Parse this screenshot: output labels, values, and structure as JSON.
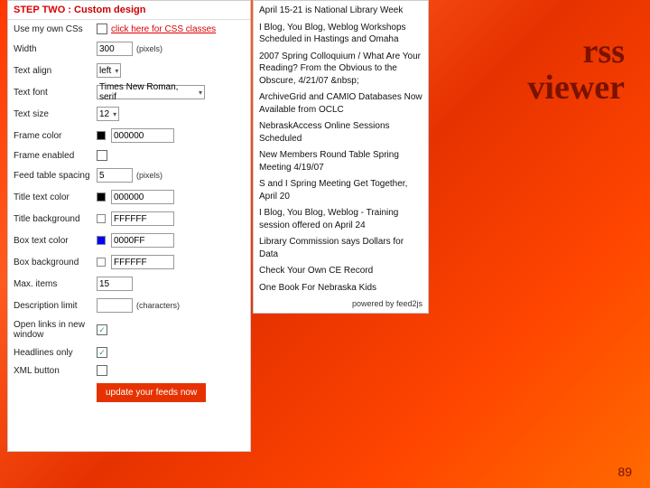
{
  "header": {
    "step": "STEP TWO :",
    "label": "Custom design"
  },
  "css_row": {
    "label": "Use my own CSs",
    "link": "click here for CSS classes"
  },
  "width_row": {
    "label": "Width",
    "value": "300",
    "suffix": "(pixels)"
  },
  "textalign_row": {
    "label": "Text align",
    "value": "left"
  },
  "textfont_row": {
    "label": "Text font",
    "value": "Times New Roman, serif"
  },
  "textsize_row": {
    "label": "Text size",
    "value": "12"
  },
  "framecolor_row": {
    "label": "Frame color",
    "value": "000000",
    "swatch": "#000000"
  },
  "frameenabled_row": {
    "label": "Frame enabled"
  },
  "feedspacing_row": {
    "label": "Feed table spacing",
    "value": "5",
    "suffix": "(pixels)"
  },
  "titletext_row": {
    "label": "Title text color",
    "value": "000000",
    "swatch": "#000000"
  },
  "titlebg_row": {
    "label": "Title background",
    "value": "FFFFFF",
    "swatch": "#ffffff"
  },
  "boxtext_row": {
    "label": "Box text color",
    "value": "0000FF",
    "swatch": "#0000ff"
  },
  "boxbg_row": {
    "label": "Box background",
    "value": "FFFFFF",
    "swatch": "#ffffff"
  },
  "maxitems_row": {
    "label": "Max. items",
    "value": "15"
  },
  "desclimit_row": {
    "label": "Description limit",
    "value": "",
    "suffix": "(characters)"
  },
  "openlinks_row": {
    "label": "Open links in new window",
    "checked": "✓"
  },
  "headlines_row": {
    "label": "Headlines only",
    "checked": "✓"
  },
  "xmlbutton_row": {
    "label": "XML button"
  },
  "update_btn": "update your feeds now",
  "feed": {
    "items": [
      "April 15-21 is National Library Week",
      "I Blog, You Blog, Weblog Workshops Scheduled in Hastings and Omaha",
      "2007 Spring Colloquium / What Are Your Reading? From the Obvious to the Obscure, 4/21/07 &nbsp;",
      "ArchiveGrid and CAMIO Databases Now Available from OCLC",
      "NebraskAccess Online Sessions Scheduled",
      "New Members Round Table Spring Meeting 4/19/07",
      "S and I Spring Meeting Get Together, April 20",
      "I Blog, You Blog, Weblog - Training session offered on April 24",
      "Library Commission says Dollars for Data",
      "Check Your Own CE Record",
      "One Book For Nebraska Kids"
    ],
    "powered": "powered by feed2js"
  },
  "title": {
    "line1": "rss",
    "line2": "viewer"
  },
  "page_number": "89"
}
